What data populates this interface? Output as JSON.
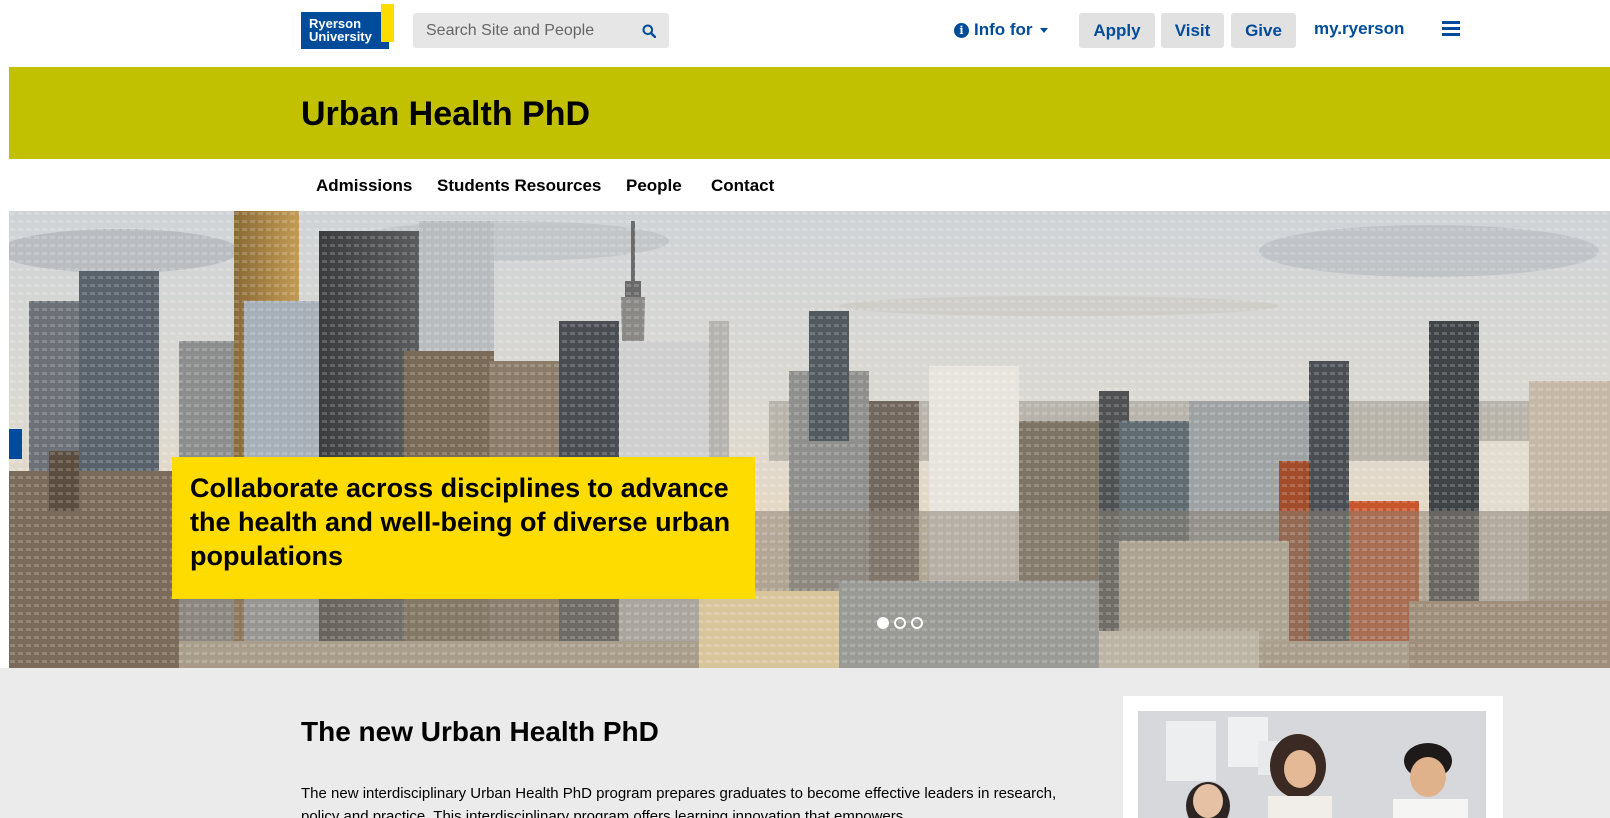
{
  "header": {
    "logo": {
      "line1": "Ryerson",
      "line2": "University"
    },
    "search": {
      "placeholder": "Search Site and People",
      "icon": "search-icon"
    },
    "info_for": {
      "label": "Info for",
      "icon": "info-circle-icon"
    },
    "buttons": {
      "apply": "Apply",
      "visit": "Visit",
      "give": "Give"
    },
    "my_link": "my.ryerson",
    "menu_icon": "hamburger-icon"
  },
  "program": {
    "title": "Urban Health PhD"
  },
  "subnav": {
    "items": [
      {
        "label": "Admissions"
      },
      {
        "label": "Students Resources"
      },
      {
        "label": "People"
      },
      {
        "label": "Contact"
      }
    ]
  },
  "hero": {
    "caption": "Collaborate across disciplines to advance the health and well-being of diverse urban populations",
    "slides_total": 3,
    "slide_active": 1
  },
  "content": {
    "title": "The new Urban Health PhD",
    "body": "The new interdisciplinary Urban Health PhD program prepares graduates to become effective leaders in research, policy and practice. This interdisciplinary program offers learning innovation that empowers"
  },
  "colors": {
    "brand_blue": "#004c9b",
    "brand_yellow": "#ffdc00",
    "program_band": "#c1c001",
    "content_bg": "#ebebeb"
  }
}
